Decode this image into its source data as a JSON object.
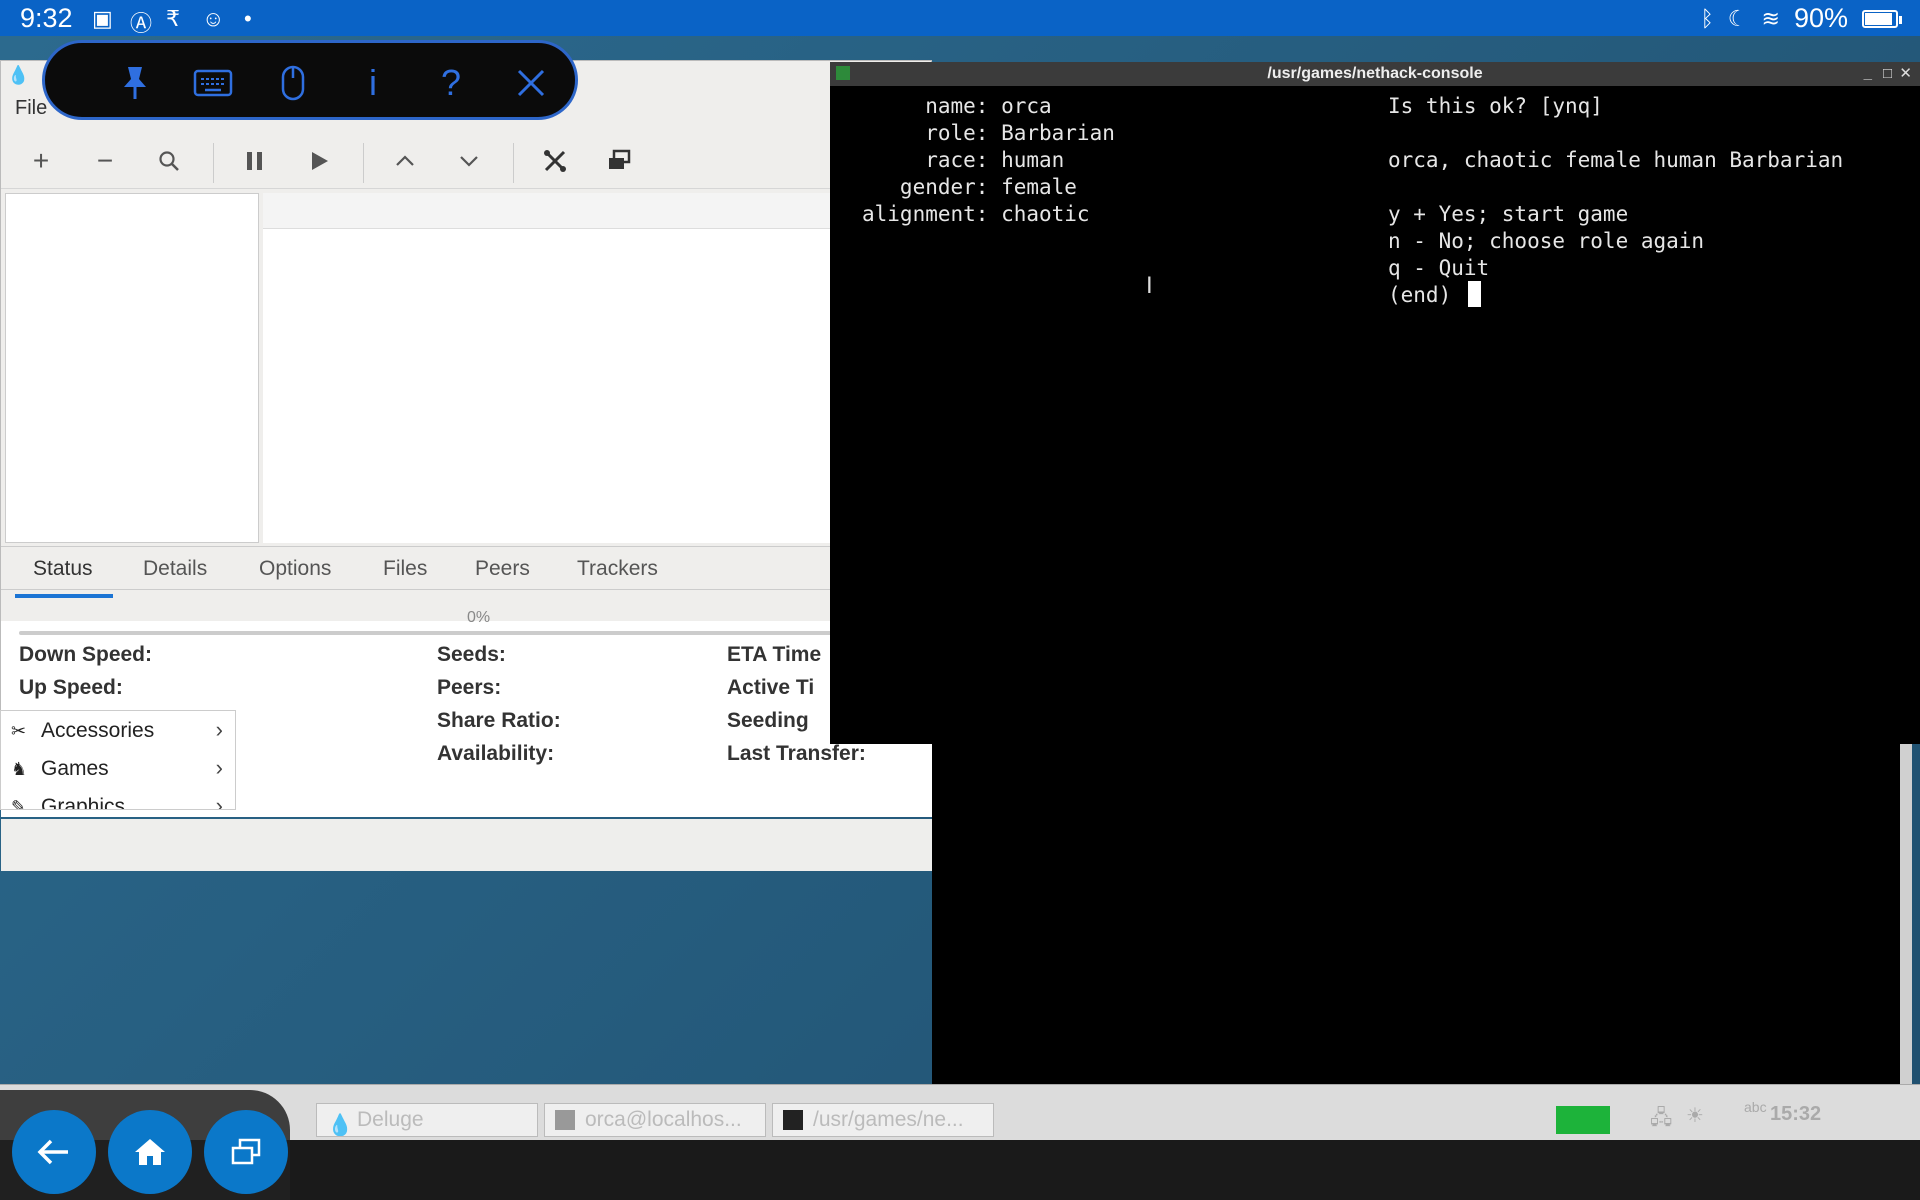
{
  "android_status": {
    "time": "9:32",
    "battery": "90%",
    "icons": [
      "image-icon",
      "a-icon",
      "rupee-icon",
      "face-icon",
      "dot-icon",
      "bluetooth-icon",
      "moon-icon",
      "wifi-icon",
      "battery-icon"
    ]
  },
  "pill_toolbar": {
    "buttons": [
      "pin-icon",
      "keyboard-icon",
      "mouse-icon",
      "info-icon",
      "help-icon",
      "close-icon"
    ],
    "info_glyph": "i",
    "help_glyph": "?"
  },
  "deluge": {
    "menu_file": "File",
    "tabs": [
      "Status",
      "Details",
      "Options",
      "Files",
      "Peers",
      "Trackers"
    ],
    "progress": "0%",
    "props": {
      "down_speed": "Down Speed:",
      "up_speed": "Up Speed:",
      "seeds": "Seeds:",
      "peers": "Peers:",
      "share_ratio": "Share Ratio:",
      "availability": "Availability:",
      "eta_time": "ETA Time",
      "active_time": "Active Ti",
      "seeding": "Seeding",
      "last_transfer": "Last Transfer:"
    }
  },
  "app_menu": {
    "items": [
      "Accessories",
      "Games",
      "Graphics"
    ]
  },
  "terminal": {
    "title": "/usr/games/nethack-console",
    "left_lines": [
      "     name: orca",
      "     role: Barbarian",
      "     race: human",
      "   gender: female",
      "alignment: chaotic"
    ],
    "right_lines": [
      "Is this ok? [ynq]",
      "",
      "orca, chaotic female human Barbarian",
      "",
      "y + Yes; start game",
      "n - No; choose role again",
      "q - Quit",
      "(end) "
    ]
  },
  "taskbar": {
    "tasks": [
      "Deluge",
      "orca@localhos...",
      "/usr/games/ne..."
    ],
    "clock": "15:32",
    "keyboard_indicator": "abc"
  },
  "colors": {
    "android_blue": "#0a63c6",
    "accent_blue": "#1b74d4",
    "terminal_bg": "#000000",
    "terminal_fg": "#e6e6e6"
  }
}
